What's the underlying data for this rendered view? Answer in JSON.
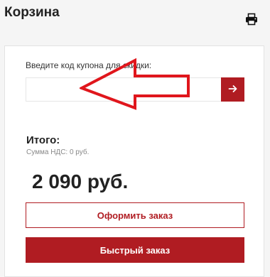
{
  "header": {
    "title": "Корзина",
    "print_icon": "printer-icon"
  },
  "coupon": {
    "label": "Введите код купона для скидки:",
    "value": "",
    "apply_icon": "arrow-right-icon"
  },
  "summary": {
    "total_label": "Итого:",
    "vat_text": "Сумма НДС: 0 руб.",
    "total_value": "2 090 руб."
  },
  "actions": {
    "checkout_label": "Оформить заказ",
    "quick_order_label": "Быстрый заказ"
  },
  "colors": {
    "accent": "#b01c22",
    "annotation": "#e0161c",
    "background": "#f5f5f5"
  }
}
